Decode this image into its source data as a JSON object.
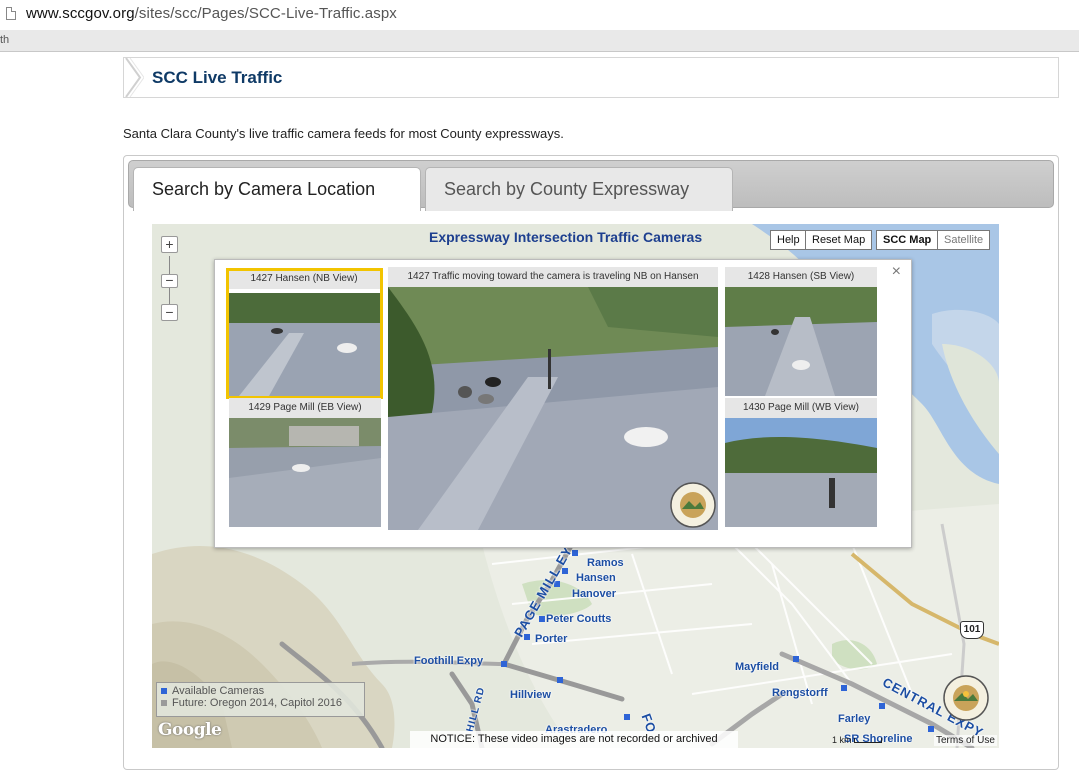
{
  "browser": {
    "url_host": "www.sccgov.org",
    "url_path": "/sites/scc/Pages/SCC-Live-Traffic.aspx",
    "bookmark_fragment": "th"
  },
  "page": {
    "title": "SCC Live Traffic",
    "intro": "Santa Clara County's live traffic camera feeds for most County expressways."
  },
  "tabs": [
    {
      "label": "Search by Camera Location",
      "active": true
    },
    {
      "label": "Search by County Expressway",
      "active": false
    }
  ],
  "map": {
    "title": "Expressway Intersection Traffic Cameras",
    "buttons": {
      "help": "Help",
      "reset": "Reset Map",
      "scc_map": "SCC Map",
      "satellite": "Satellite"
    },
    "zoom": {
      "in": "+",
      "out": "−"
    },
    "popup": {
      "close": "×",
      "cameras": [
        {
          "label": "1427 Hansen (NB View)",
          "selected": true
        },
        {
          "label": "1427 Traffic moving toward the camera is traveling NB on Hansen"
        },
        {
          "label": "1428 Hansen (SB View)"
        },
        {
          "label": "1429 Page Mill (EB View)"
        },
        {
          "label": "1430 Page Mill (WB View)"
        }
      ]
    },
    "places": [
      "Ramos",
      "Hansen",
      "Hanover",
      "Peter Coutts",
      "Porter",
      "Foothill Expy",
      "Hillview",
      "Arastradero",
      "Mayfield",
      "Rengstorff",
      "Farley",
      "SR Shoreline"
    ],
    "roads": [
      "PAGE MILL EY",
      "CENTRAL EXPY",
      "HILL RD",
      "FO",
      "101"
    ],
    "legend": {
      "available": "Available Cameras",
      "future": "Future: Oregon 2014, Capitol 2016",
      "available_color": "#2e64d6",
      "future_color": "#9a9a9a"
    },
    "notice": "NOTICE: These video images are not recorded or archived",
    "attribution": "Google",
    "scale": "1 km",
    "terms": "Terms of Use"
  }
}
